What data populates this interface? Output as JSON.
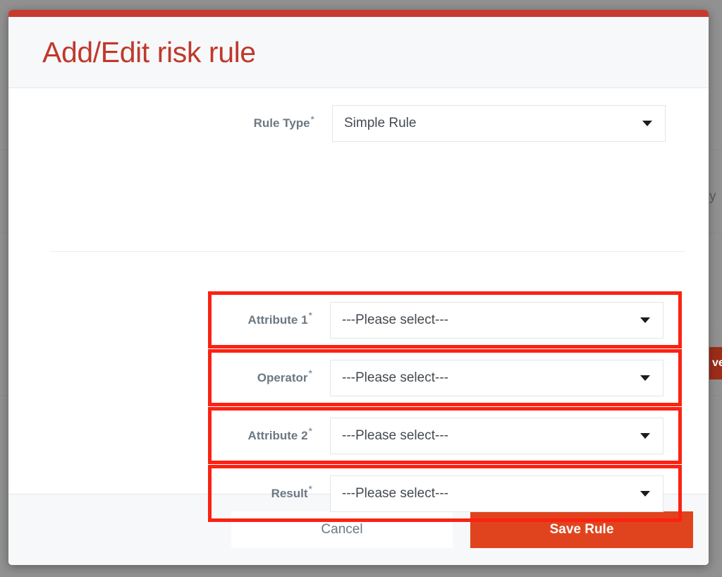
{
  "background": {
    "text_fragment_right": "y",
    "button_fragment_right": "ve",
    "ellipsis_fragment": "···"
  },
  "modal": {
    "title": "Add/Edit risk rule",
    "accent_color": "#c63b2f",
    "title_color": "#c0392b",
    "highlight_color": "#fb2213",
    "rule_type": {
      "label": "Rule Type",
      "required_marker": "*",
      "value": "Simple Rule",
      "caret_icon": "chevron-down-icon"
    },
    "fields": [
      {
        "label": "Attribute 1",
        "required_marker": "*",
        "value": "---Please select---",
        "highlighted": true,
        "caret_icon": "chevron-down-icon"
      },
      {
        "label": "Operator",
        "required_marker": "*",
        "value": "---Please select---",
        "highlighted": true,
        "caret_icon": "chevron-down-icon"
      },
      {
        "label": "Attribute 2",
        "required_marker": "*",
        "value": "---Please select---",
        "highlighted": true,
        "caret_icon": "chevron-down-icon"
      },
      {
        "label": "Result",
        "required_marker": "*",
        "value": "---Please select---",
        "highlighted": true,
        "caret_icon": "chevron-down-icon"
      }
    ],
    "footer": {
      "cancel_label": "Cancel",
      "save_label": "Save Rule",
      "save_color": "#e0441e"
    }
  }
}
